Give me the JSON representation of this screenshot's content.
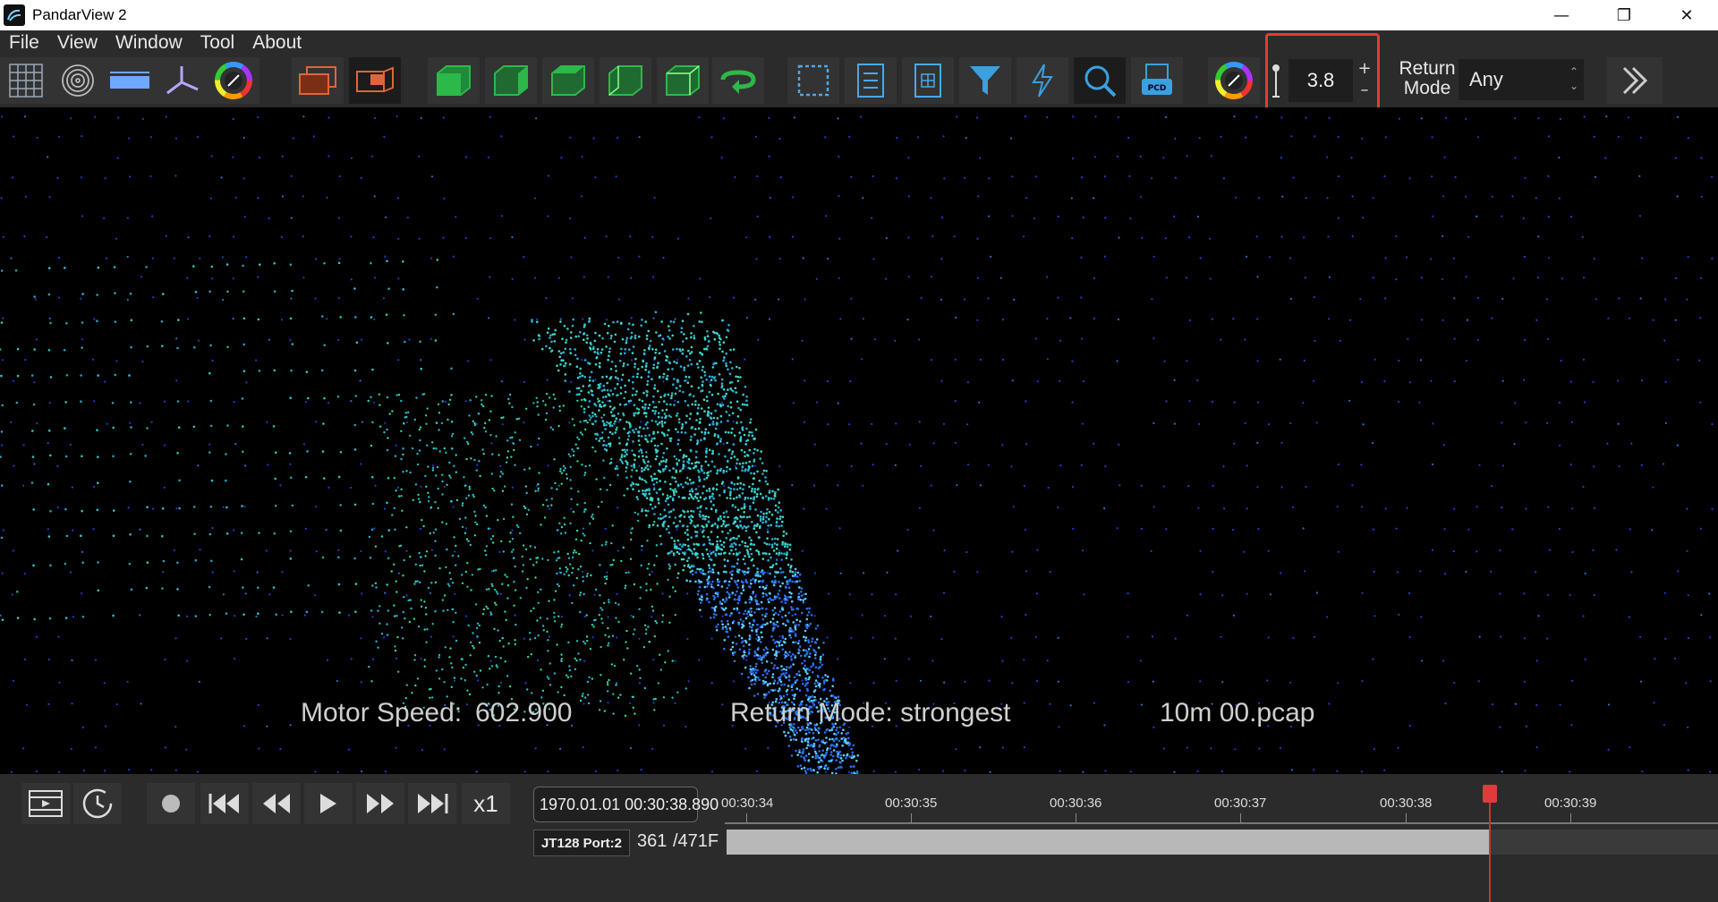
{
  "window": {
    "title": "PandarView 2",
    "minimize_icon": "minimize-icon",
    "restore_icon": "restore-icon",
    "close_icon": "close-icon"
  },
  "menu": [
    "File",
    "View",
    "Window",
    "Tool",
    "About"
  ],
  "toolbar": {
    "icons": [
      "grid-icon",
      "polar-grid-icon",
      "ruler-icon",
      "axes-icon",
      "color-wheel-icon",
      "view-2d-icon",
      "view-3d-icon",
      "cube-front-icon",
      "cube-side-icon",
      "cube-top-icon",
      "cube-left-icon",
      "cube-iso-icon",
      "rotate-icon",
      "select-box-icon",
      "list-icon",
      "table-icon",
      "filter-icon",
      "lightning-icon",
      "search-icon",
      "pcd-icon",
      "color-wheel-2-icon"
    ],
    "point_size": {
      "value": "3.8",
      "plus": "+",
      "minus": "–"
    },
    "return_mode_label": "Return Mode",
    "return_mode_value": "Any",
    "more_icon": "double-chevron-right-icon"
  },
  "viewport": {
    "motor_speed_label": "Motor Speed:",
    "motor_speed_value": "602.900",
    "return_mode": "Return Mode: strongest",
    "file_name": "10m 00.pcap"
  },
  "playback": {
    "speed": "x1",
    "datetime": "1970.01.01 00:30:38.890",
    "timeline_labels": [
      "00:30:34",
      "00:30:35",
      "00:30:36",
      "00:30:37",
      "00:30:38",
      "00:30:39"
    ],
    "port": "JT128 Port:2",
    "current_frame": "361",
    "total_frames": "/471F",
    "progress": 0.77
  },
  "colors": {
    "accent": "#e03b3b",
    "cube_green": "#2db84a",
    "icon_blue": "#3aa0e0",
    "toolbar_bg": "#2b2b2b"
  }
}
